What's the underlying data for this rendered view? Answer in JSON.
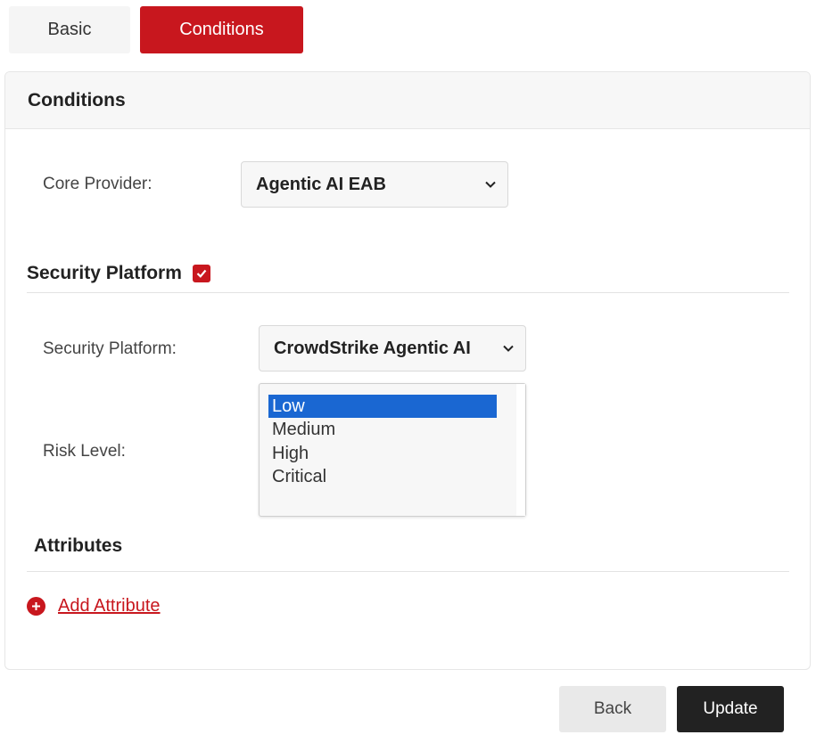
{
  "tabs": [
    {
      "label": "Basic",
      "active": false
    },
    {
      "label": "Conditions",
      "active": true
    }
  ],
  "panel": {
    "title": "Conditions",
    "core_provider": {
      "label": "Core Provider:",
      "selected": "Agentic AI EAB"
    },
    "security_platform_section": {
      "title": "Security Platform",
      "checked": true,
      "platform": {
        "label": "Security Platform:",
        "selected": "CrowdStrike Agentic AI"
      },
      "risk_level": {
        "label": "Risk Level:",
        "options": [
          "Low",
          "Medium",
          "High",
          "Critical"
        ],
        "selected": "Low"
      }
    },
    "attributes": {
      "title": "Attributes",
      "add_label": "Add Attribute"
    }
  },
  "footer": {
    "back_label": "Back",
    "update_label": "Update"
  },
  "colors": {
    "accent": "#c8171e",
    "selected_option": "#1a67d2",
    "dark_button": "#222222"
  }
}
